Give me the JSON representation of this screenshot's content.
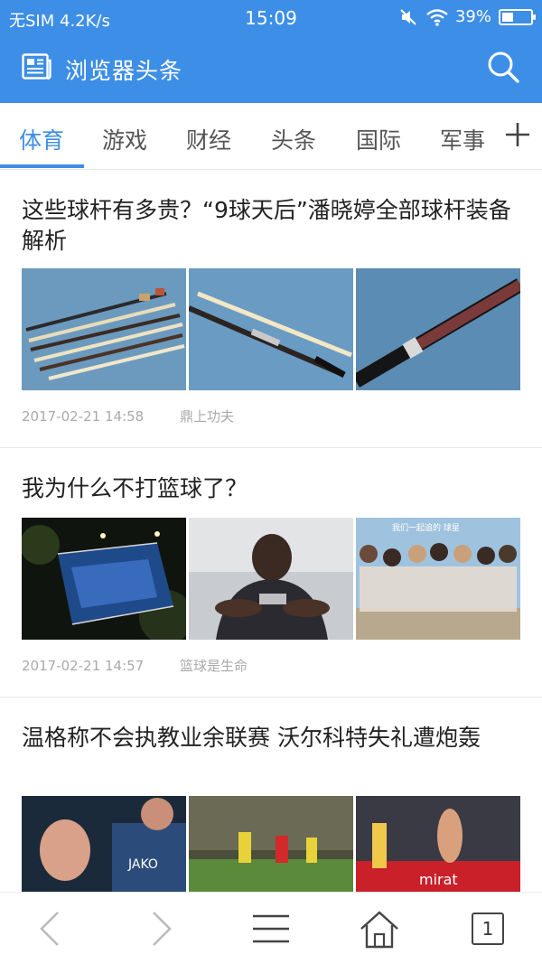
{
  "status_bar": {
    "carrier": "无SIM",
    "speed": "4.2K/s",
    "time": "15:09",
    "battery": "39%",
    "battery_level": 0.39
  },
  "header": {
    "title": "浏览器头条",
    "icon": "newspaper-icon",
    "search_icon": "search-icon"
  },
  "tabs": [
    {
      "label": "体育",
      "active": true
    },
    {
      "label": "游戏",
      "active": false
    },
    {
      "label": "财经",
      "active": false
    },
    {
      "label": "头条",
      "active": false
    },
    {
      "label": "国际",
      "active": false
    },
    {
      "label": "军事",
      "active": false
    }
  ],
  "tab_add_icon": "plus-icon",
  "articles": [
    {
      "title": "这些球杆有多贵？“9球天后”潘晓婷全部球杆装备解析",
      "time": "2017-02-21 14:58",
      "source": "鼎上功夫",
      "images": [
        "billiard-cues-set",
        "billiard-cue-pair",
        "billiard-cue-closeup"
      ]
    },
    {
      "title": "我为什么不打篮球了？",
      "time": "2017-02-21 14:57",
      "source": "篮球是生命",
      "images": [
        "night-basketball-court",
        "usa-player-sitting",
        "players-group-photo"
      ],
      "image_caption": "我们一起追的 球星"
    },
    {
      "title": "温格称不会执教业余联赛 沃尔科特失礼遭炮轰",
      "images": [
        "football-goalkeeper",
        "football-match-action",
        "football-fan-celebration"
      ]
    }
  ],
  "bottom_nav": {
    "back_icon": "back-arrow-icon",
    "forward_icon": "forward-arrow-icon",
    "menu_icon": "menu-icon",
    "home_icon": "home-icon",
    "tab_count": "1"
  },
  "colors": {
    "brand": "#3d8ee6",
    "meta_text": "#aaaaaa"
  }
}
